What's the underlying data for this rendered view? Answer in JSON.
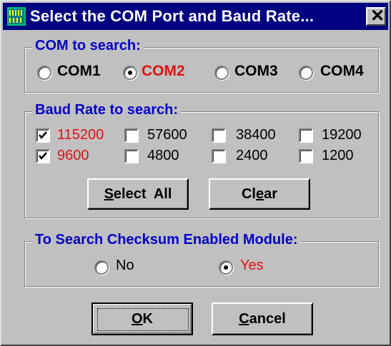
{
  "window": {
    "title": "Select the COM Port and Baud Rate...",
    "close_symbol": "✕"
  },
  "com_group": {
    "legend": "COM to search:",
    "options": [
      {
        "label": "COM1",
        "selected": false
      },
      {
        "label": "COM2",
        "selected": true
      },
      {
        "label": "COM3",
        "selected": false
      },
      {
        "label": "COM4",
        "selected": false
      }
    ]
  },
  "baud_group": {
    "legend": "Baud Rate to search:",
    "rates": [
      {
        "label": "115200",
        "checked": true
      },
      {
        "label": "57600",
        "checked": false
      },
      {
        "label": "38400",
        "checked": false
      },
      {
        "label": "19200",
        "checked": false
      },
      {
        "label": "9600",
        "checked": true
      },
      {
        "label": "4800",
        "checked": false
      },
      {
        "label": "2400",
        "checked": false
      },
      {
        "label": "1200",
        "checked": false
      }
    ],
    "select_all": {
      "mnemonic": "S",
      "rest": "elect  All"
    },
    "clear": {
      "pre": "Cl",
      "mnemonic": "e",
      "post": "ar"
    }
  },
  "checksum_group": {
    "legend": "To Search Checksum Enabled Module:",
    "options": [
      {
        "label": "No",
        "selected": false
      },
      {
        "label": "Yes",
        "selected": true
      }
    ]
  },
  "buttons": {
    "ok": {
      "mnemonic": "O",
      "rest": "K"
    },
    "cancel": {
      "mnemonic": "C",
      "rest": "ancel"
    }
  },
  "colors": {
    "title_bar": "#000080",
    "legend_text": "#0000c8",
    "selected_text": "#e01010",
    "dialog_face": "#c0c0c0"
  }
}
